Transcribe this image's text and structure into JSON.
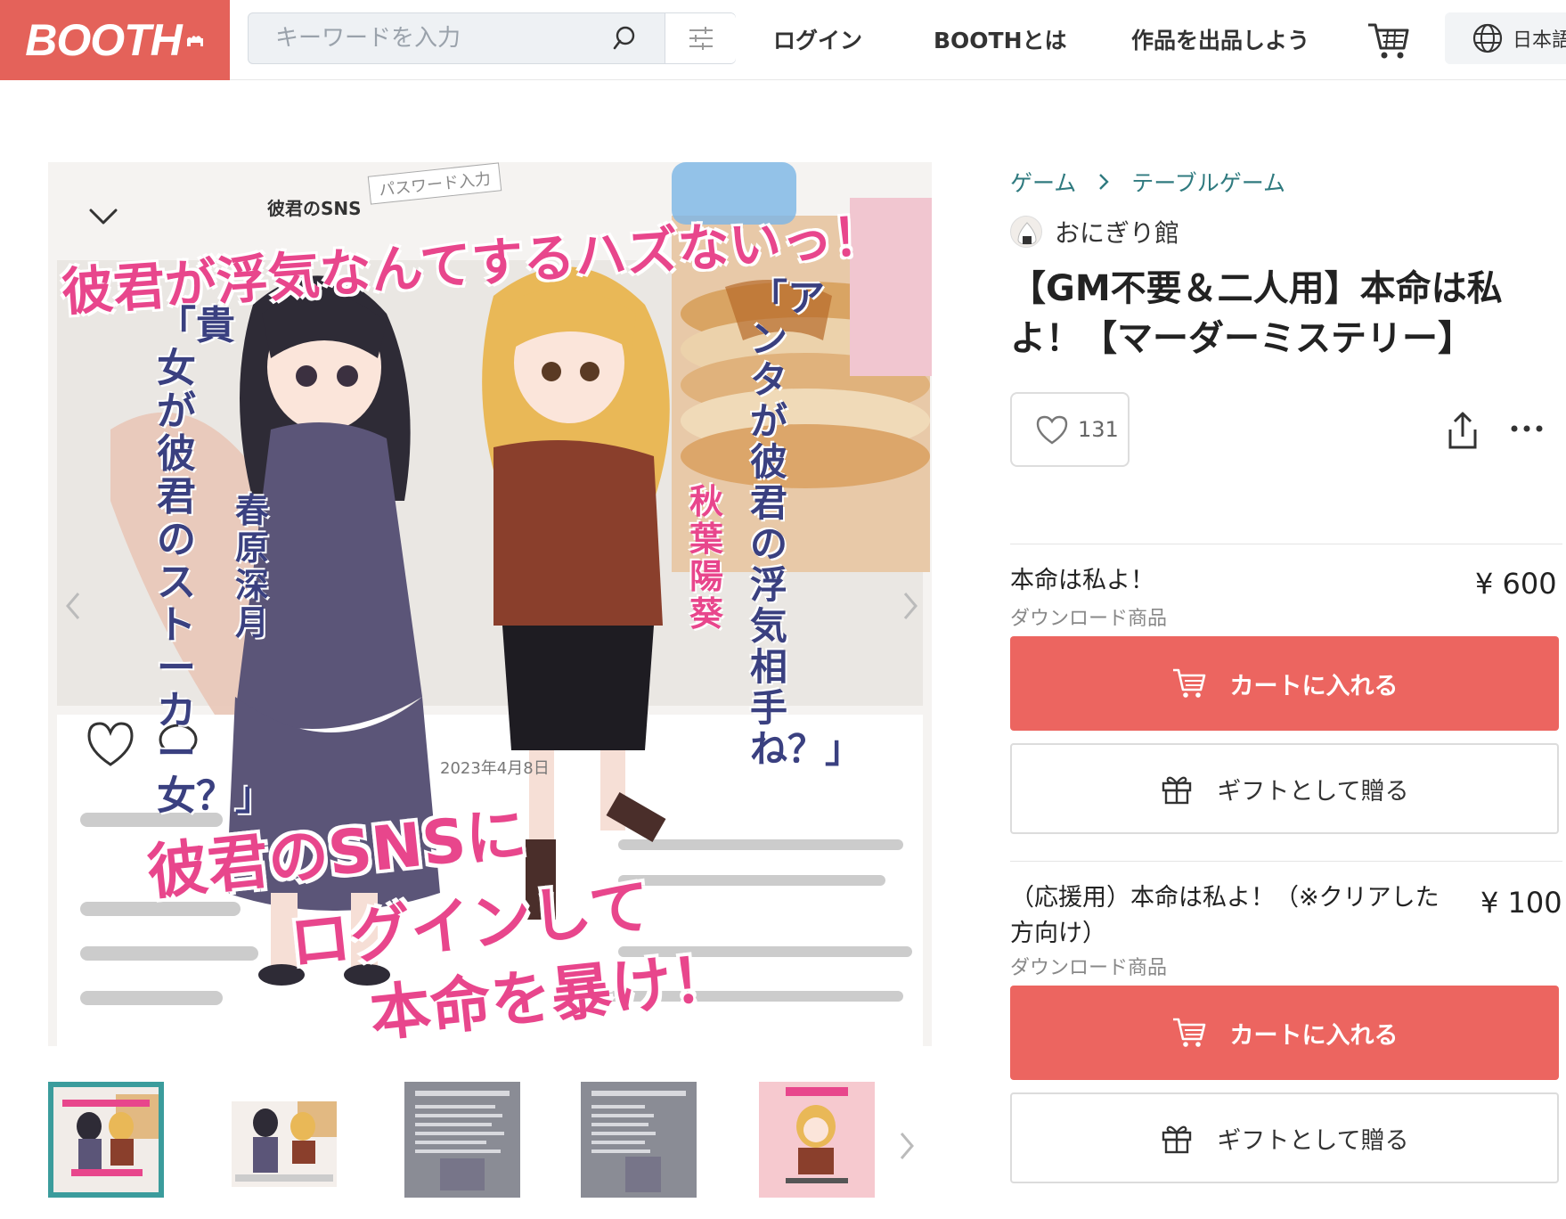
{
  "header": {
    "logo_text": "BOOTH",
    "search_placeholder": "キーワードを入力",
    "nav": {
      "login": "ログイン",
      "about": "BOOTHとは",
      "sell": "作品を出品しよう"
    },
    "language": "日本語"
  },
  "breadcrumb": [
    "ゲーム",
    "テーブルゲーム"
  ],
  "shop": {
    "name": "おにぎり館"
  },
  "product": {
    "title": "【GM不要＆二人用】本命は私よ！【マーダーミステリー】",
    "likes": "131",
    "variants": [
      {
        "name": "本命は私よ！",
        "type": "ダウンロード商品",
        "price": "¥ 600",
        "cart_label": "カートに入れる",
        "gift_label": "ギフトとして贈る"
      },
      {
        "name": "（応援用）本命は私よ！（※クリアした方向け）",
        "type": "ダウンロード商品",
        "price": "¥ 100",
        "cart_label": "カートに入れる",
        "gift_label": "ギフトとして贈る"
      }
    ]
  },
  "main_image": {
    "caption_top": "彼君が浮気なんてするハズないっ！",
    "caption_left": "「貴女が彼君のストーカー女？」",
    "caption_right": "「アンタが彼君の浮気相手ね？」",
    "name_left": "春原 深月",
    "name_right": "秋葉 陽葵",
    "caption_bottom_1": "彼君のSNSに",
    "caption_bottom_2": "ログインして",
    "caption_bottom_3": "本命を暴け！",
    "sns_label": "彼君のSNS",
    "password_label": "パスワード入力",
    "date_label": "2023年4月8日"
  },
  "thumbnails": [
    "thumb-1",
    "thumb-2",
    "thumb-3",
    "thumb-4",
    "thumb-5"
  ],
  "colors": {
    "brand": "#e4625a",
    "cart_button": "#ec6560",
    "link": "#2f7a7f",
    "thumb_active_border": "#3b9c9c",
    "caption_pink": "#e8468c",
    "caption_navy": "#3a4080"
  },
  "icons": {
    "search": "search-icon",
    "filter": "filter-icon",
    "cart": "cart-icon",
    "globe": "globe-icon",
    "heart": "heart-icon",
    "share": "share-icon",
    "more": "more-icon",
    "gift": "gift-icon"
  }
}
